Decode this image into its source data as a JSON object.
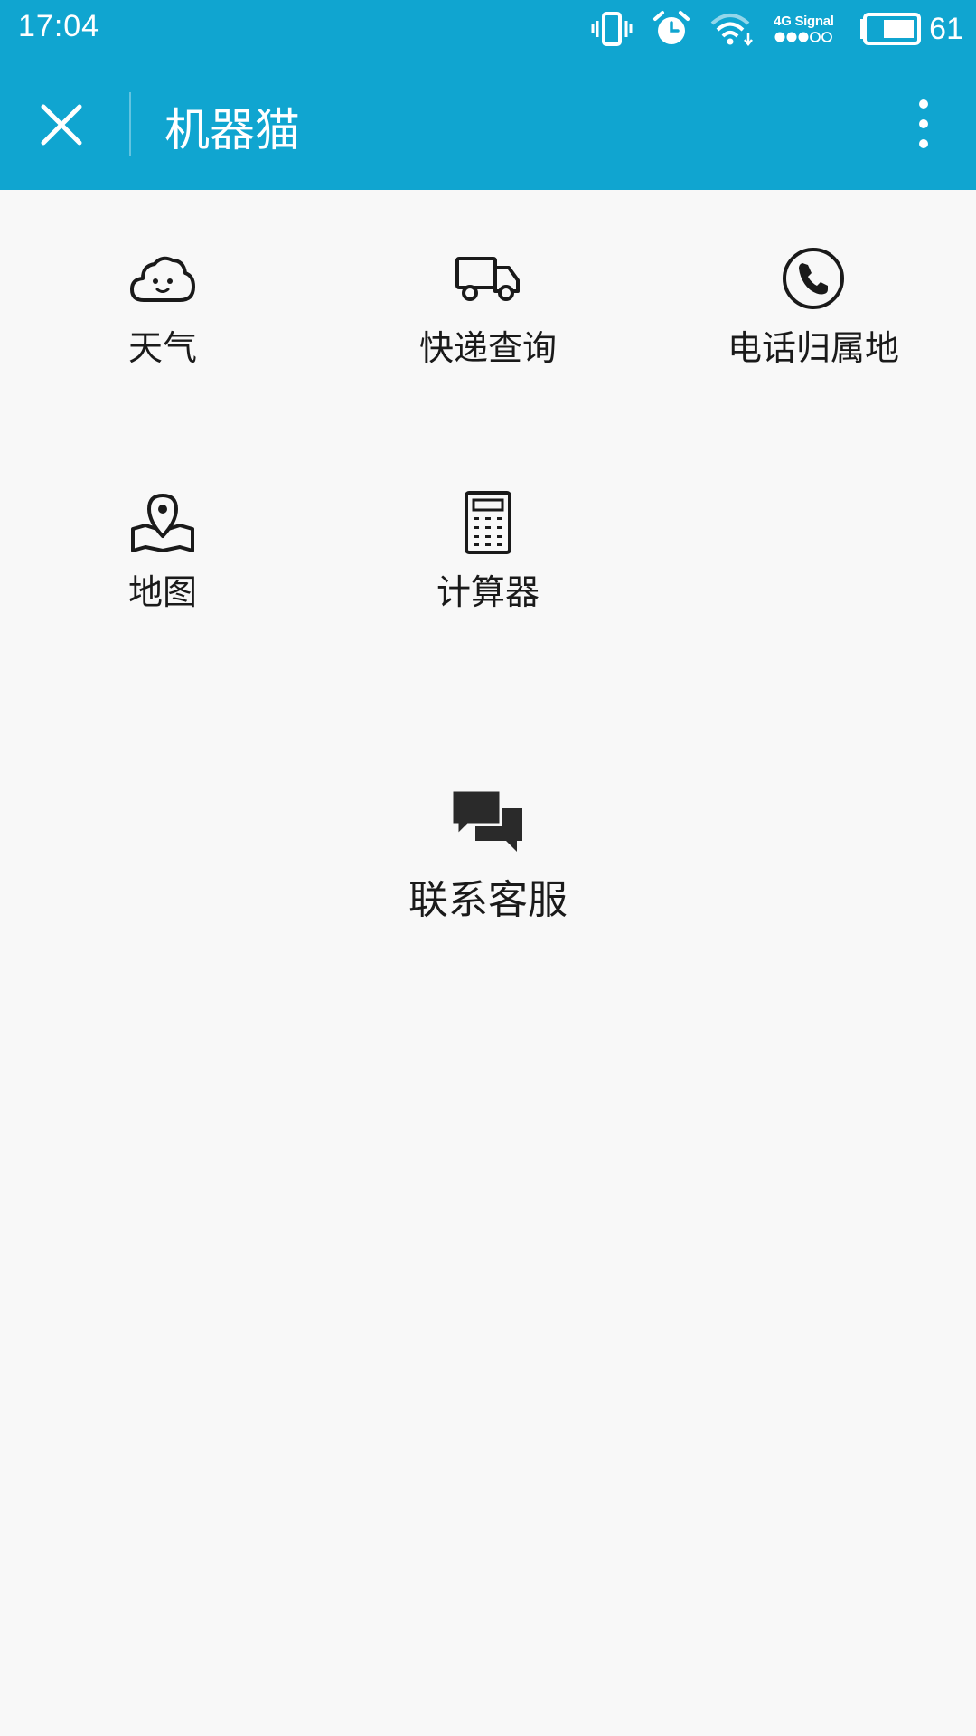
{
  "status_bar": {
    "time": "17:04",
    "network_label": "4G Signal",
    "battery_level": "61",
    "icons": [
      "vibrate-icon",
      "alarm-icon",
      "wifi-icon",
      "signal-dots-icon",
      "battery-icon"
    ]
  },
  "app_bar": {
    "title": "机器猫",
    "close_icon": "close-icon",
    "more_icon": "more-vertical-icon",
    "background_color": "#10a5d0"
  },
  "tiles": [
    {
      "label": "天气",
      "icon": "cloud-smile-icon"
    },
    {
      "label": "快递查询",
      "icon": "truck-icon"
    },
    {
      "label": "电话归属地",
      "icon": "phone-circle-icon"
    },
    {
      "label": "地图",
      "icon": "map-pin-icon"
    },
    {
      "label": "计算器",
      "icon": "calculator-icon"
    }
  ],
  "contact": {
    "label": "联系客服",
    "icon": "chat-bubbles-icon"
  }
}
